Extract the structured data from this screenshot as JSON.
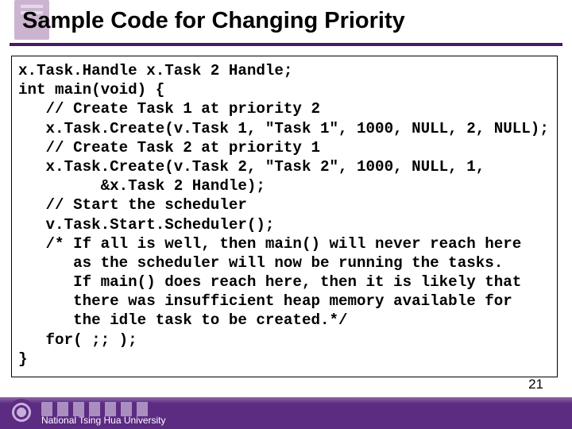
{
  "slide": {
    "title": "Sample Code for Changing Priority",
    "code": "x.Task.Handle x.Task 2 Handle;\nint main(void) {\n   // Create Task 1 at priority 2\n   x.Task.Create(v.Task 1, \"Task 1\", 1000, NULL, 2, NULL);\n   // Create Task 2 at priority 1\n   x.Task.Create(v.Task 2, \"Task 2\", 1000, NULL, 1,\n         &x.Task 2 Handle);\n   // Start the scheduler\n   v.Task.Start.Scheduler();\n   /* If all is well, then main() will never reach here\n      as the scheduler will now be running the tasks.\n      If main() does reach here, then it is likely that\n      there was insufficient heap memory available for\n      the idle task to be created.*/\n   for( ;; );\n}"
  },
  "footer": {
    "university": "National Tsing Hua University",
    "page_number": "21"
  }
}
